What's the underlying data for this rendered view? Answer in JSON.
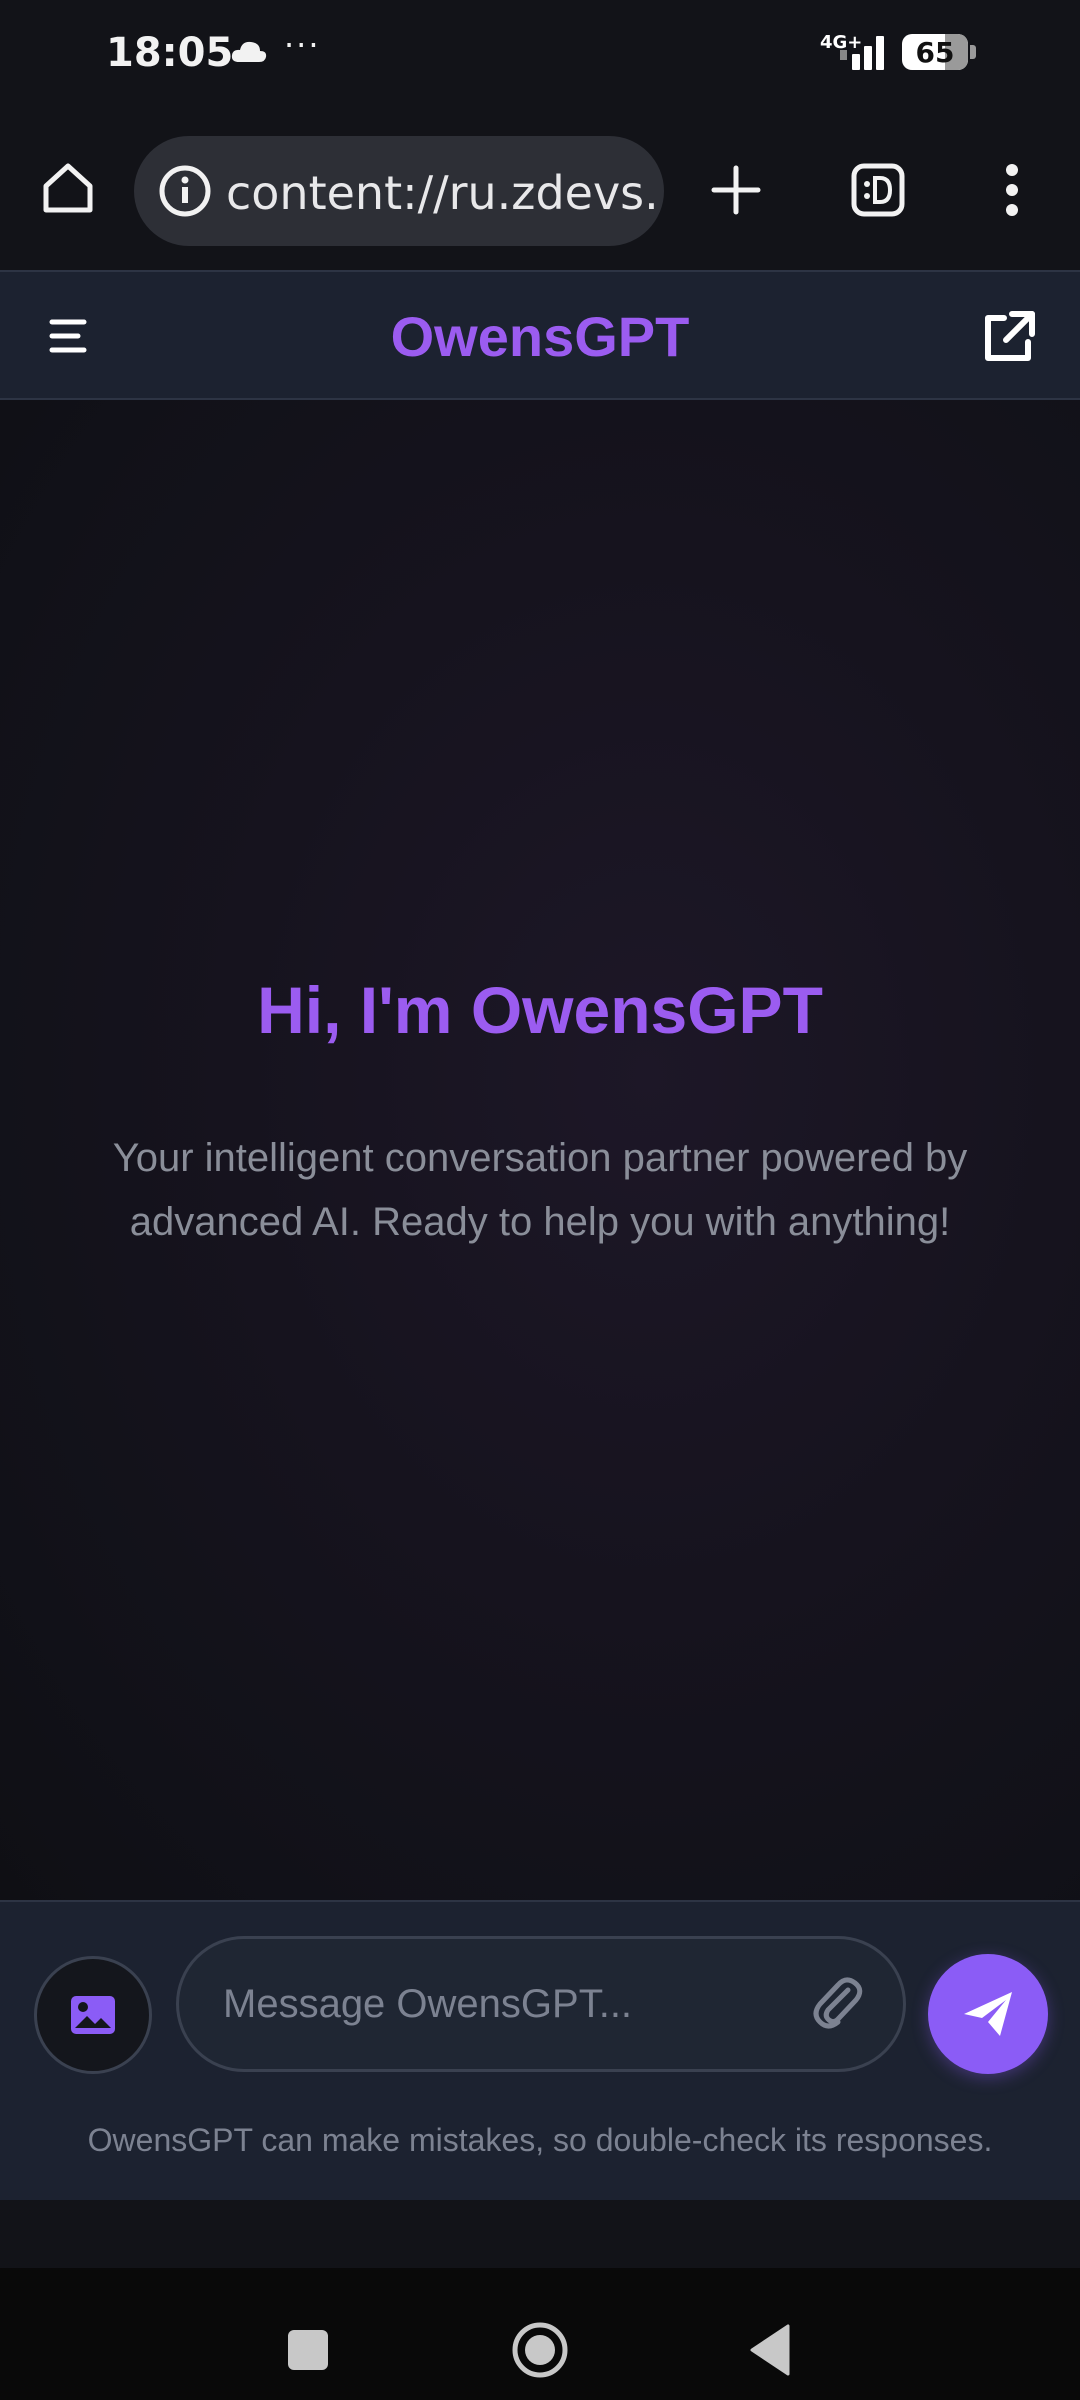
{
  "status_bar": {
    "time": "18:05",
    "network": "4G+",
    "battery": "65",
    "battery_level": 0.65,
    "icons": [
      "cloud-icon",
      "more-dots-icon",
      "signal-icon",
      "battery-icon"
    ]
  },
  "browser": {
    "url": "content://ru.zdevs.za",
    "icons": [
      "home-icon",
      "info-icon",
      "plus-icon",
      "tab-switcher-icon",
      "more-vert-icon"
    ]
  },
  "header": {
    "title": "OwensGPT",
    "icons": [
      "menu-icon",
      "external-link-icon"
    ]
  },
  "main": {
    "greeting": "Hi, I'm OwensGPT",
    "subtitle": "Your intelligent conversation partner powered by advanced AI. Ready to help you with anything!"
  },
  "composer": {
    "placeholder": "Message OwensGPT...",
    "value": "",
    "disclaimer": "OwensGPT can make mistakes, so double-check its responses.",
    "icons": [
      "image-icon",
      "paperclip-icon",
      "send-icon"
    ]
  },
  "nav": {
    "icons": [
      "recents-icon",
      "home-circle-icon",
      "back-icon"
    ]
  },
  "colors": {
    "accent": "#8b5cf6",
    "title": "#9b5cf0",
    "header_bg": "#1c2230",
    "muted_text": "#8a8e99"
  }
}
